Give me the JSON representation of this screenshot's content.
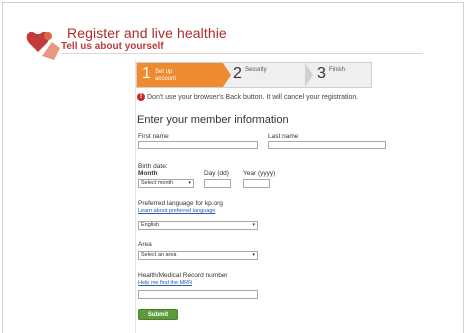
{
  "header": {
    "title": "Register and live healthie",
    "subtitle": "Tell us about yourself"
  },
  "steps": [
    {
      "num": "1",
      "label_line1": "Set up",
      "label_line2": "account"
    },
    {
      "num": "2",
      "label_line1": "Security",
      "label_line2": ""
    },
    {
      "num": "3",
      "label_line1": "Finish",
      "label_line2": ""
    }
  ],
  "warning": {
    "text": "Don't use your browser's Back button. It will cancel your registration."
  },
  "form": {
    "heading": "Enter your member information",
    "first_name_label": "First name",
    "last_name_label": "Last name",
    "birth_date_label": "Birth date:",
    "month_label": "Month",
    "month_value": "Select month",
    "day_label": "Day (dd)",
    "year_label": "Year (yyyy)",
    "language_label": "Preferred language for kp.org",
    "language_help_link": "Learn about preferred language",
    "language_value": "English",
    "area_label": "Area",
    "area_value": "Select an area",
    "mrn_label": "Health/Medical Record number",
    "mrn_help_link": "Help me find the MRN",
    "submit_label": "Submit"
  }
}
